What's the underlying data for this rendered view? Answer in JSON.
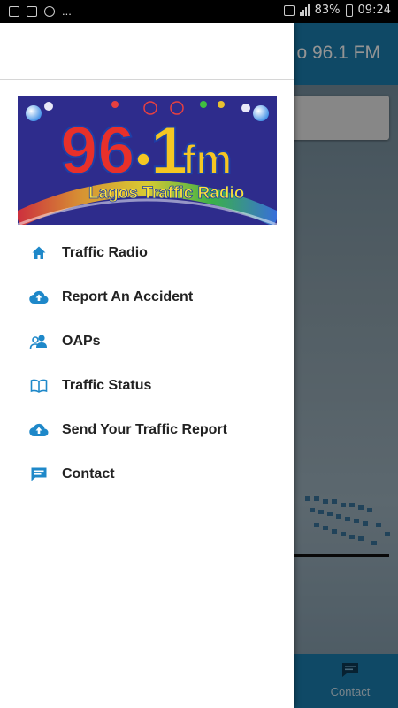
{
  "status_bar": {
    "left_more": "...",
    "battery_percent": "83%",
    "time": "09:24"
  },
  "app": {
    "title": "o 96.1 FM",
    "bottom_nav": {
      "contact_label": "Contact",
      "contact_icon": "chat-icon"
    }
  },
  "drawer": {
    "banner": {
      "freq_96": "96",
      "freq_1": "1",
      "fm": "fm",
      "subtitle": "Lagos Traffic Radio"
    },
    "menu": [
      {
        "label": "Traffic Radio",
        "icon": "home-icon"
      },
      {
        "label": "Report An Accident",
        "icon": "cloud-upload-icon"
      },
      {
        "label": "OAPs",
        "icon": "people-icon"
      },
      {
        "label": "Traffic Status",
        "icon": "book-icon"
      },
      {
        "label": "Send Your Traffic Report",
        "icon": "cloud-upload-icon"
      },
      {
        "label": "Contact",
        "icon": "chat-icon"
      }
    ]
  },
  "colors": {
    "accent": "#1b7fb0",
    "icon_blue": "#1e88c9"
  }
}
